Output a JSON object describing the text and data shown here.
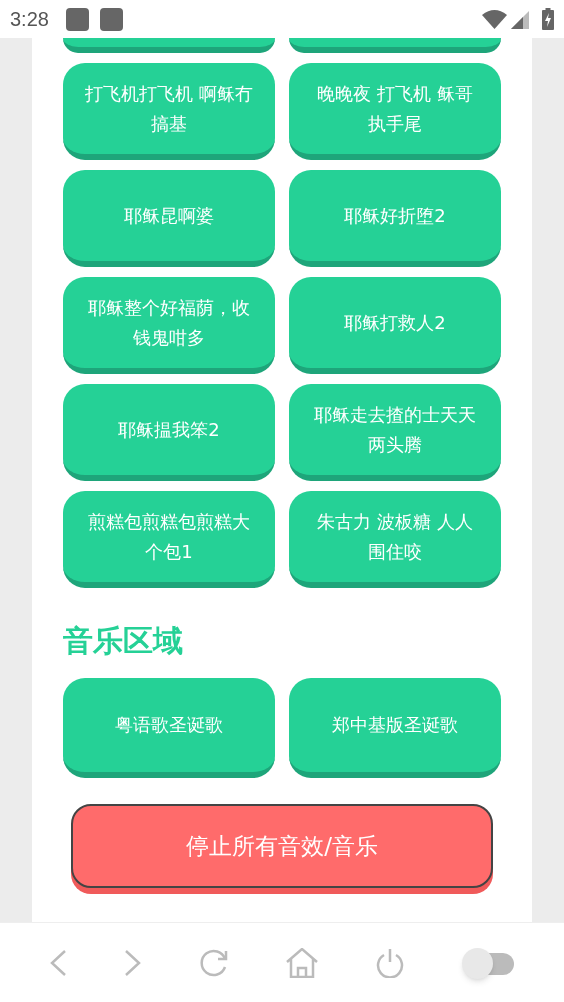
{
  "status_bar": {
    "time": "3:28"
  },
  "cut_off_buttons": [
    {
      "kind": "cut"
    },
    {
      "kind": "cut"
    }
  ],
  "sound_rows": [
    {
      "buttons": [
        {
          "kind": "full",
          "label": "打飞机打飞机 啊稣冇搞基"
        },
        {
          "kind": "full",
          "label": "晚晚夜 打飞机 稣哥执手尾"
        }
      ]
    },
    {
      "buttons": [
        {
          "kind": "full",
          "label": "耶稣昆啊婆"
        },
        {
          "kind": "full",
          "label": "耶稣好折堕2"
        }
      ]
    },
    {
      "buttons": [
        {
          "kind": "full",
          "label": "耶稣整个好福荫，收钱鬼咁多"
        },
        {
          "kind": "full",
          "label": "耶稣打救人2"
        }
      ]
    },
    {
      "buttons": [
        {
          "kind": "full",
          "label": "耶稣揾我笨2"
        },
        {
          "kind": "full",
          "label": "耶稣走去揸的士天天两头腾"
        }
      ]
    },
    {
      "buttons": [
        {
          "kind": "full",
          "label": "煎糕包煎糕包煎糕大个包1"
        },
        {
          "kind": "full",
          "label": "朱古力 波板糖 人人围住咬"
        }
      ]
    }
  ],
  "music_section": {
    "title": "音乐区域",
    "buttons": [
      {
        "label": "粤语歌圣诞歌"
      },
      {
        "label": "郑中基版圣诞歌"
      }
    ]
  },
  "stop_button": {
    "label": "停止所有音效/音乐"
  },
  "nav_bar": {
    "toggle_on": false
  }
}
